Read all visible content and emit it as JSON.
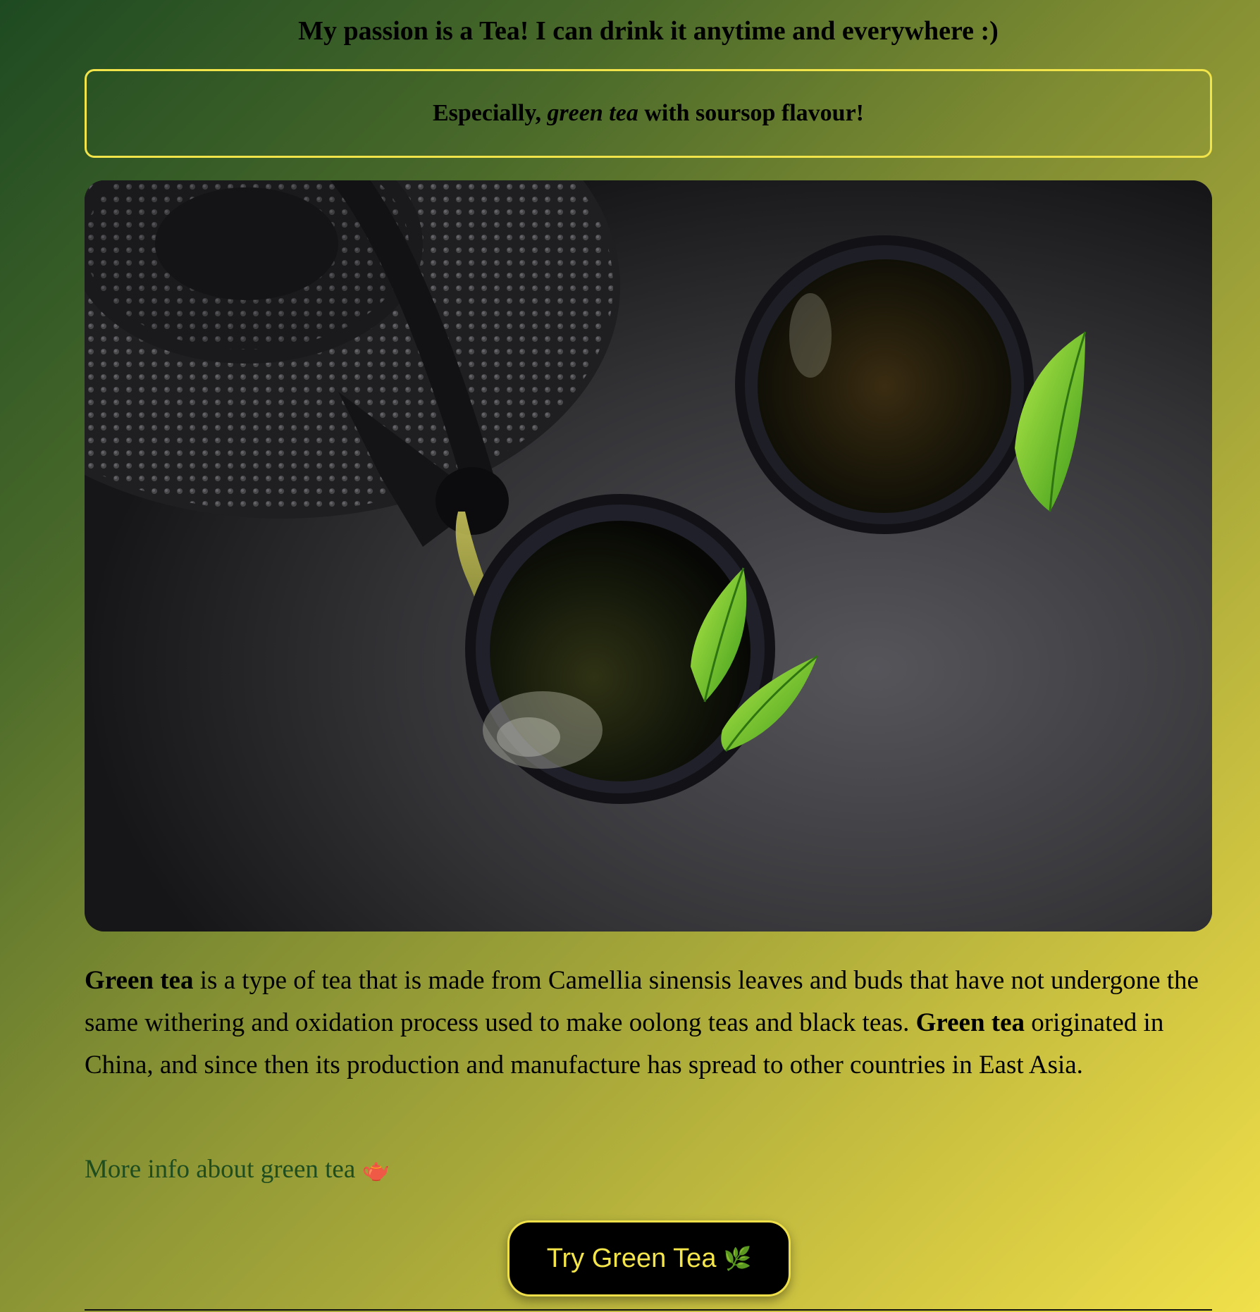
{
  "headline": "My passion is a Tea! I can drink it anytime and everywhere :)",
  "highlight": {
    "prefix": "Especially, ",
    "emphasis": "green tea",
    "suffix": " with soursop flavour!"
  },
  "description": {
    "term_1": "Green tea",
    "text_1": " is a type of tea that is made from Camellia sinensis leaves and buds that have not undergone the same withering and oxidation process used to make oolong teas and black teas. ",
    "term_2": "Green tea",
    "text_2": " originated in China, and since then its production and manufacture has spread to other countries in East Asia."
  },
  "more_info_link": {
    "label": "More info about green tea",
    "icon": "teapot-icon",
    "glyph": "🫖"
  },
  "cta_button": {
    "label": "Try Green Tea",
    "icon": "herb-icon",
    "glyph": "🌿"
  },
  "colors": {
    "accent": "#f1e34a",
    "link": "#1f4d1f",
    "button_bg": "#000000",
    "button_text": "#f3e54a"
  }
}
